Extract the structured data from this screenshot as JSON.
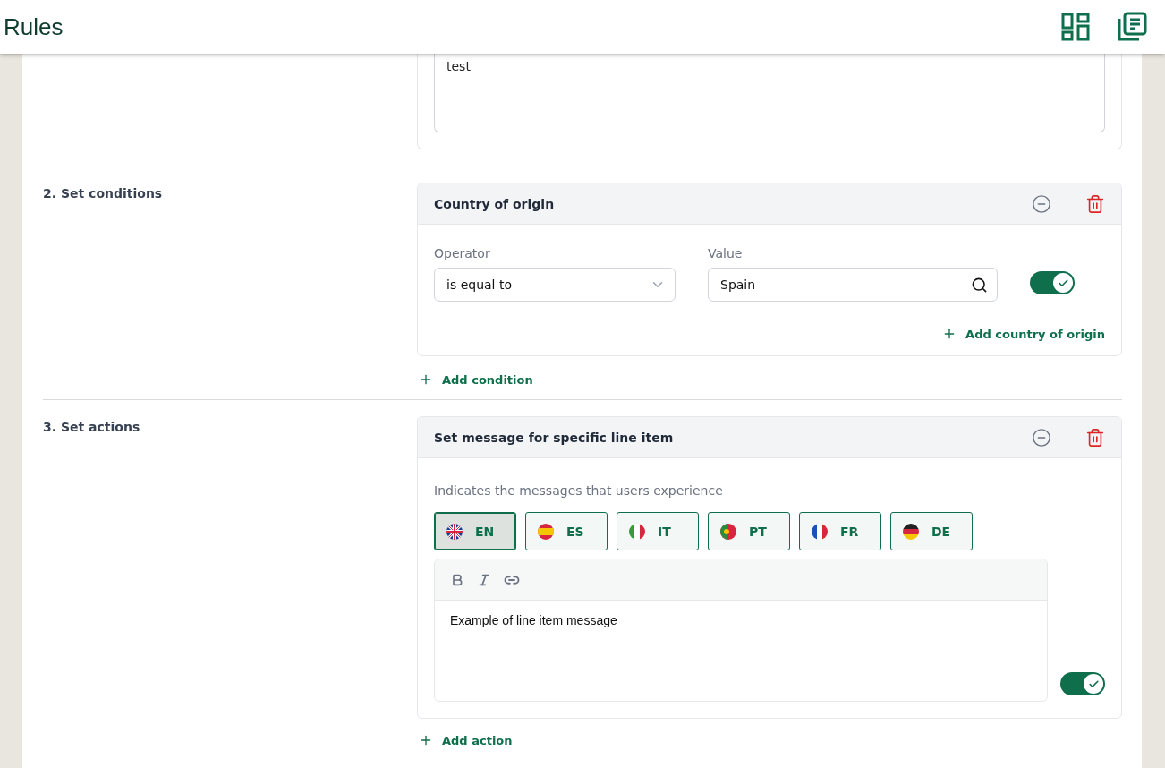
{
  "header": {
    "title": "Rules"
  },
  "description_box": {
    "value": "test"
  },
  "conditions": {
    "label": "2. Set conditions",
    "card_title": "Country of origin",
    "operator_label": "Operator",
    "operator_value": "is equal to",
    "value_label": "Value",
    "value": "Spain",
    "enabled": true,
    "add_value": "Add country of origin",
    "add_condition": "Add condition"
  },
  "actions": {
    "label": "3. Set actions",
    "card_title": "Set message for specific line item",
    "hint": "Indicates the messages that users experience",
    "languages": [
      {
        "label": "EN",
        "kind": "gb",
        "selected": true
      },
      {
        "label": "ES",
        "kind": "es",
        "selected": false
      },
      {
        "label": "IT",
        "kind": "it",
        "selected": false
      },
      {
        "label": "PT",
        "kind": "pt",
        "selected": false
      },
      {
        "label": "FR",
        "kind": "fr",
        "selected": false
      },
      {
        "label": "DE",
        "kind": "de",
        "selected": false
      }
    ],
    "message": "Example of line item message",
    "enabled": true,
    "add_action": "Add action"
  }
}
